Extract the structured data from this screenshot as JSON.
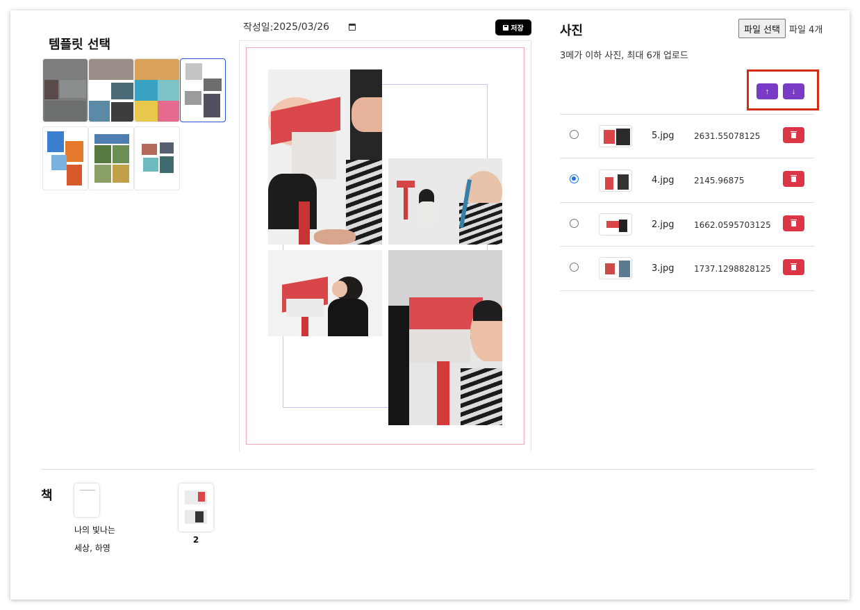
{
  "templates": {
    "title": "템플릿 선택",
    "selected_index": 3,
    "count": 7
  },
  "editor": {
    "date_label": "작성일:",
    "date_value": "2025/03/26",
    "save_label": "저장"
  },
  "photos": {
    "title": "사진",
    "file_button_label": "파일 선택",
    "file_count_label": "파일 4개",
    "note": "3메가 이하 사진, 최대 6개 업로드",
    "move_up_label": "↑",
    "move_down_label": "↓",
    "items": [
      {
        "name": "5.jpg",
        "size": "2631.55078125",
        "selected": false
      },
      {
        "name": "4.jpg",
        "size": "2145.96875",
        "selected": true
      },
      {
        "name": "2.jpg",
        "size": "1662.0595703125",
        "selected": false
      },
      {
        "name": "3.jpg",
        "size": "1737.1298828125",
        "selected": false
      }
    ]
  },
  "book": {
    "label": "책",
    "cover_title_line1": "나의 빛나는",
    "cover_title_line2": "세상, 하영",
    "page_number": "2"
  },
  "colors": {
    "accent_purple": "#7a3cc7",
    "danger_red": "#dc3545",
    "highlight_red": "#d42a0f",
    "page_border_pink": "#f3a7b3"
  }
}
